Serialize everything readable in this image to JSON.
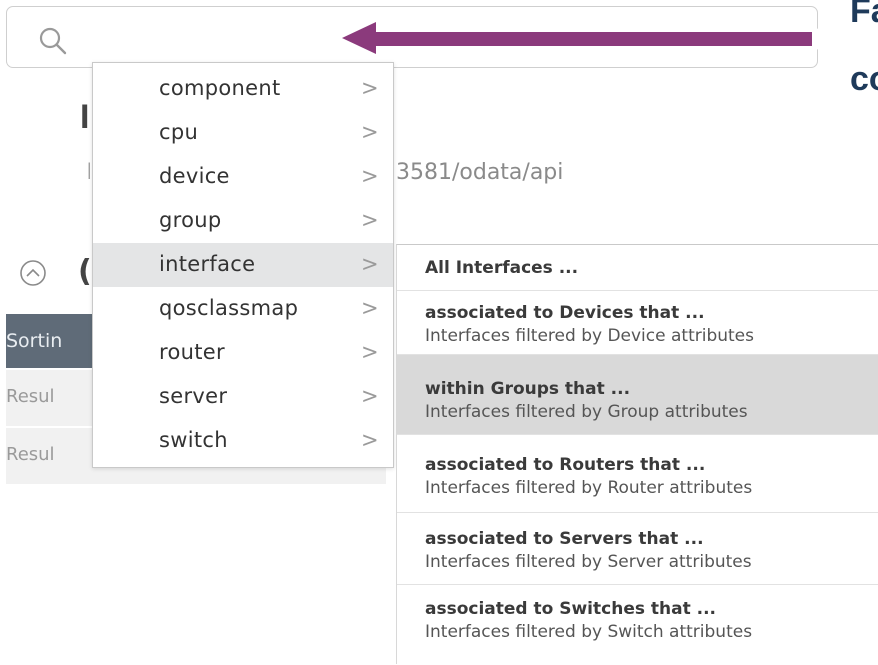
{
  "search": {
    "placeholder": ""
  },
  "heading_fragments": [
    "Fa",
    "co"
  ],
  "background": {
    "title_fragment": "I",
    "url_start": "I",
    "url_tail": "3581/odata/api",
    "section_fragment": "(",
    "sort_bar_label": "Sortin",
    "result_rows": [
      "Resul",
      "Resul"
    ]
  },
  "menu": {
    "items": [
      {
        "label": "component"
      },
      {
        "label": "cpu"
      },
      {
        "label": "device"
      },
      {
        "label": "group"
      },
      {
        "label": "interface"
      },
      {
        "label": "qosclassmap"
      },
      {
        "label": "router"
      },
      {
        "label": "server"
      },
      {
        "label": "switch"
      }
    ],
    "chevron": ">",
    "active_item": "interface"
  },
  "submenu": {
    "items": [
      {
        "title": "All Interfaces ...",
        "desc": ""
      },
      {
        "title": "associated to Devices that ...",
        "desc": "Interfaces filtered by Device attributes"
      },
      {
        "title": "within Groups that ...",
        "desc": "Interfaces filtered by Group attributes"
      },
      {
        "title": "associated to Routers that ...",
        "desc": "Interfaces filtered by Router attributes"
      },
      {
        "title": "associated to Servers that ...",
        "desc": "Interfaces filtered by Server attributes"
      },
      {
        "title": "associated to Switches that ...",
        "desc": "Interfaces filtered by Switch attributes"
      }
    ],
    "active_item": "within Groups that ..."
  },
  "colors": {
    "arrow": "#8b3a7c",
    "menu_active_bg": "#e4e5e6",
    "submenu_active_bg": "#d9d9d9",
    "sort_bar_bg": "#5f6b78",
    "heading": "#1e3a5a"
  },
  "icons": [
    "search-icon",
    "collapse-circle-icon",
    "chevron-right-icon",
    "pointer-arrow-icon"
  ]
}
